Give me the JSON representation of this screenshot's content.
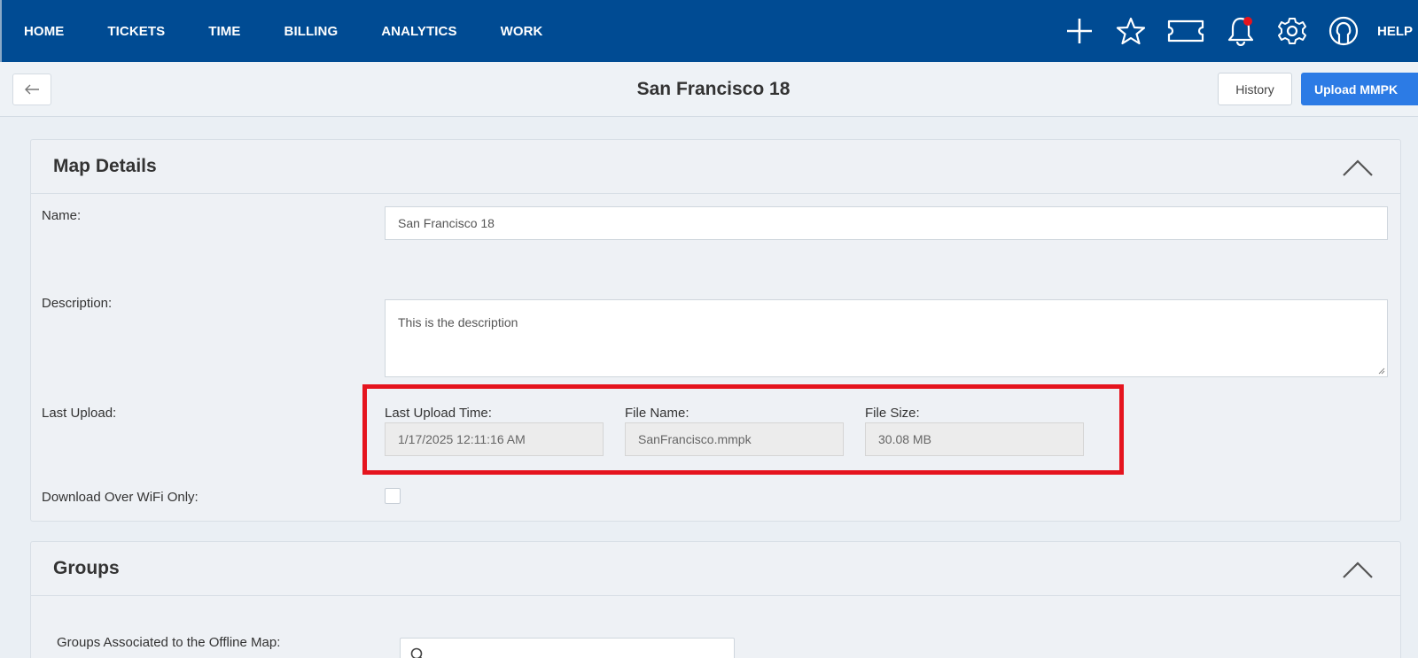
{
  "nav": {
    "items": [
      "HOME",
      "TICKETS",
      "TIME",
      "BILLING",
      "ANALYTICS",
      "WORK"
    ],
    "help_label": "HELP",
    "icons": [
      "plus-icon",
      "star-icon",
      "ticket-icon",
      "bell-icon",
      "gear-icon",
      "user-icon"
    ],
    "background_color": "#004b93",
    "notification_color": "#e5141e"
  },
  "subheader": {
    "title": "San Francisco 18",
    "history_label": "History",
    "upload_label": "Upload MMPK",
    "accent_color": "#2c7be5"
  },
  "map_details": {
    "title": "Map Details",
    "name_label": "Name:",
    "name_value": "San Francisco 18",
    "description_label": "Description:",
    "description_value": "This is the description",
    "last_upload_label": "Last Upload:",
    "last_upload_time_label": "Last Upload Time:",
    "last_upload_time_value": "1/17/2025 12:11:16 AM",
    "file_name_label": "File Name:",
    "file_name_value": "SanFrancisco.mmpk",
    "file_size_label": "File Size:",
    "file_size_value": "30.08 MB",
    "wifi_label": "Download Over WiFi Only:",
    "wifi_checked": false
  },
  "groups": {
    "title": "Groups",
    "associated_label": "Groups Associated to the Offline Map:",
    "search_value": ""
  },
  "annotation": {
    "highlight_color": "#e5141e"
  }
}
